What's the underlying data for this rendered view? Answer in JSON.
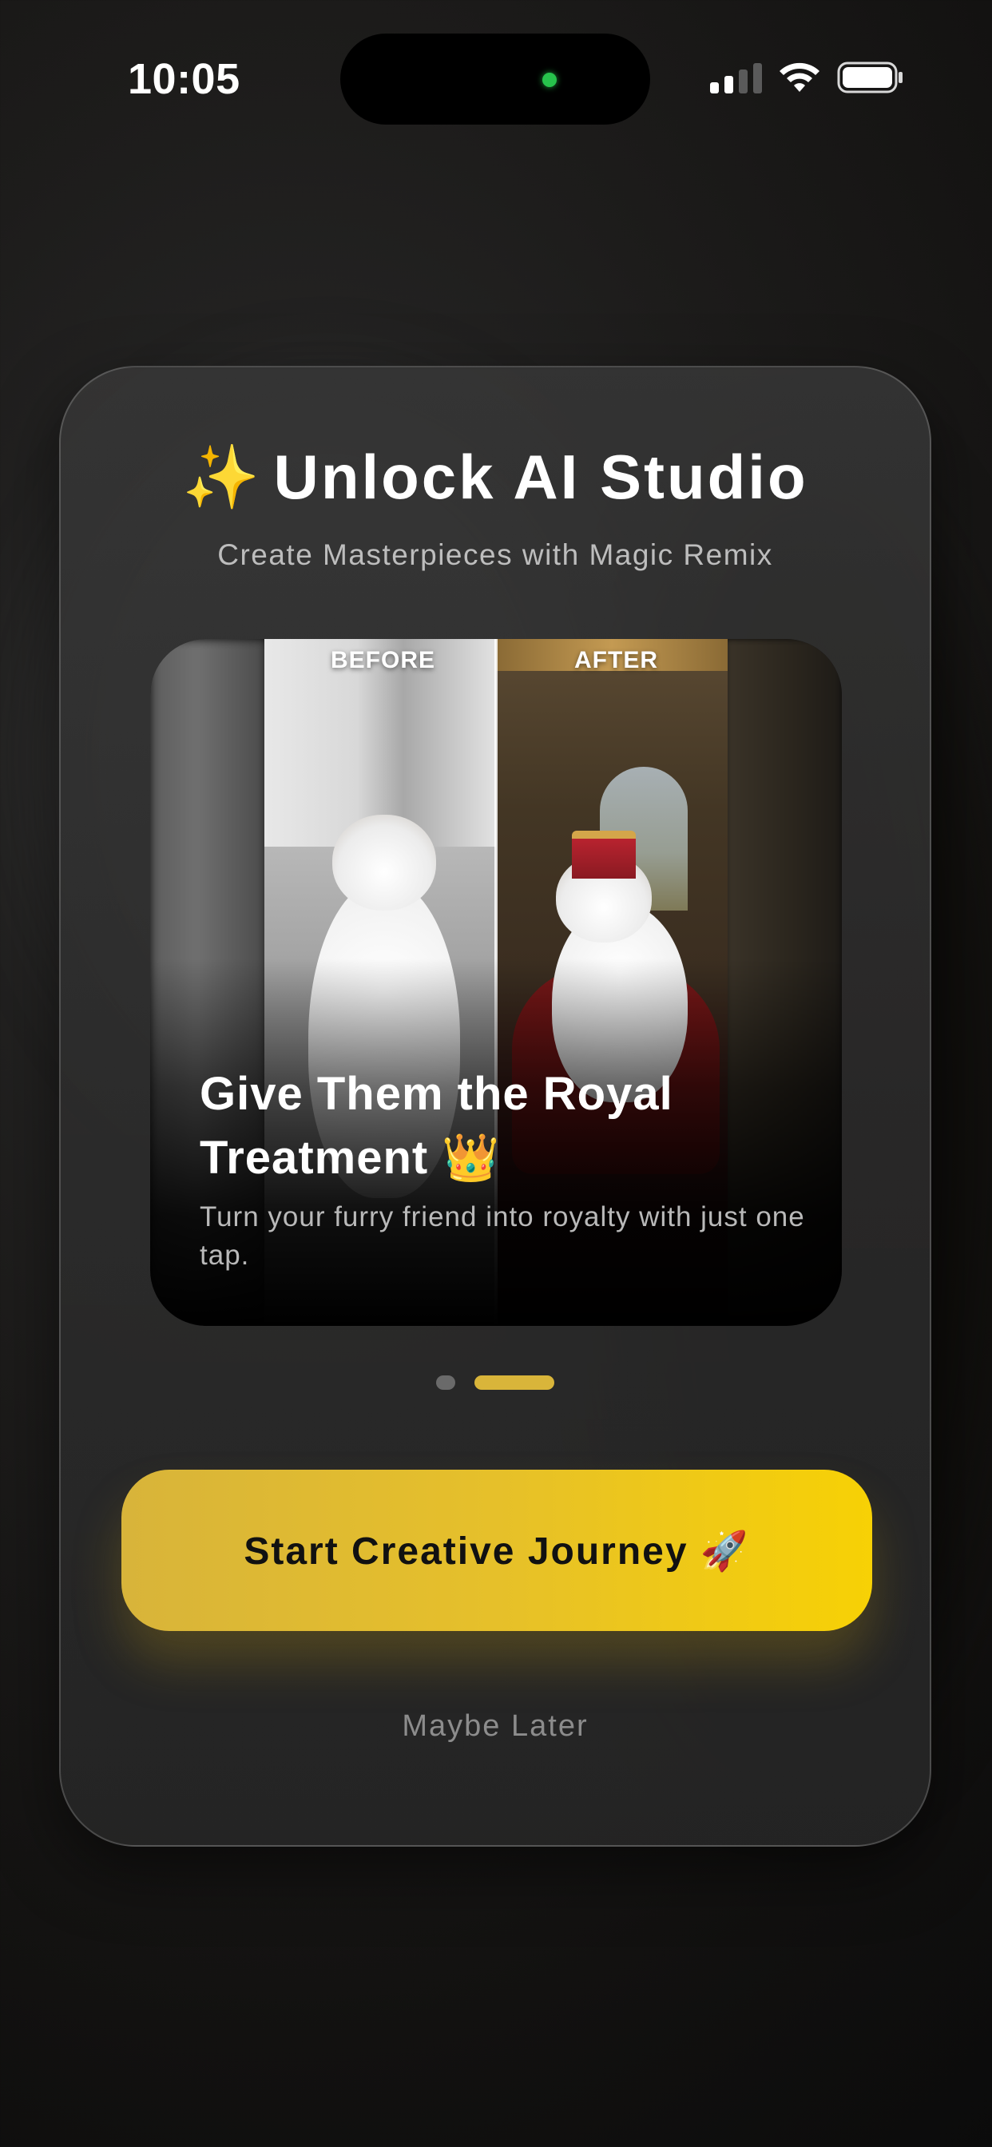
{
  "status_bar": {
    "time": "10:05",
    "icons": [
      "cellular-signal-icon",
      "wifi-icon",
      "battery-icon"
    ]
  },
  "modal": {
    "title_emoji": "✨",
    "title": "Unlock AI Studio",
    "subtitle": "Create Masterpieces with Magic Remix",
    "slide": {
      "before_label": "BEFORE",
      "after_label": "AFTER",
      "heading": "Give Them the Royal Treatment 👑",
      "body": "Turn your furry friend into royalty with just one tap."
    },
    "carousel": {
      "page_count": 2,
      "active_index": 1
    },
    "cta_label": "Start Creative Journey 🚀",
    "secondary_label": "Maybe Later"
  },
  "colors": {
    "accent": "#F5CF0A",
    "accent_start": "#D8B43A",
    "card_bg": "#2E2E2E",
    "page_bg": "#161514",
    "subtitle": "#BDBDBD",
    "muted": "#8C8C8C",
    "status_dot": "#27C24C"
  }
}
